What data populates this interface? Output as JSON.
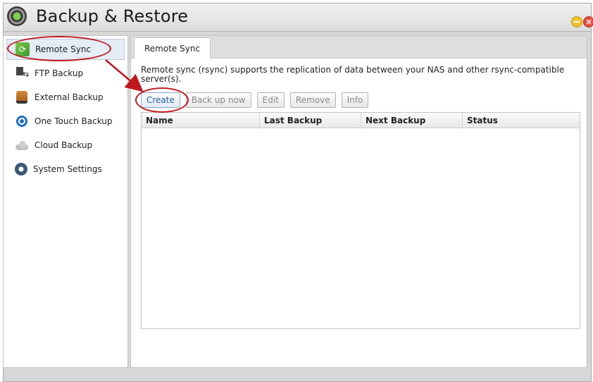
{
  "window": {
    "title": "Backup & Restore",
    "app_icon": "backup-restore-app-icon",
    "controls": [
      "minimize",
      "close"
    ]
  },
  "sidebar": {
    "items": [
      {
        "label": "Remote Sync",
        "icon": "sync-icon",
        "active": true
      },
      {
        "label": "FTP Backup",
        "icon": "ftp-icon",
        "active": false
      },
      {
        "label": "External Backup",
        "icon": "external-drive-icon",
        "active": false
      },
      {
        "label": "One Touch Backup",
        "icon": "one-touch-icon",
        "active": false
      },
      {
        "label": "Cloud Backup",
        "icon": "cloud-icon",
        "active": false
      },
      {
        "label": "System Settings",
        "icon": "gear-icon",
        "active": false
      }
    ]
  },
  "main": {
    "tab": "Remote Sync",
    "description": "Remote sync (rsync) supports the replication of data between your NAS and other rsync-compatible server(s).",
    "toolbar": {
      "create": "Create",
      "backup_now": "Back up now",
      "edit": "Edit",
      "remove": "Remove",
      "info": "Info"
    },
    "table": {
      "columns": [
        "Name",
        "Last Backup",
        "Next Backup",
        "Status"
      ],
      "rows": []
    }
  },
  "colors": {
    "annotation": "#c0181e",
    "primary_button_text": "#1f5fa8",
    "active_sidebar_bg": "#e4ecf6"
  }
}
